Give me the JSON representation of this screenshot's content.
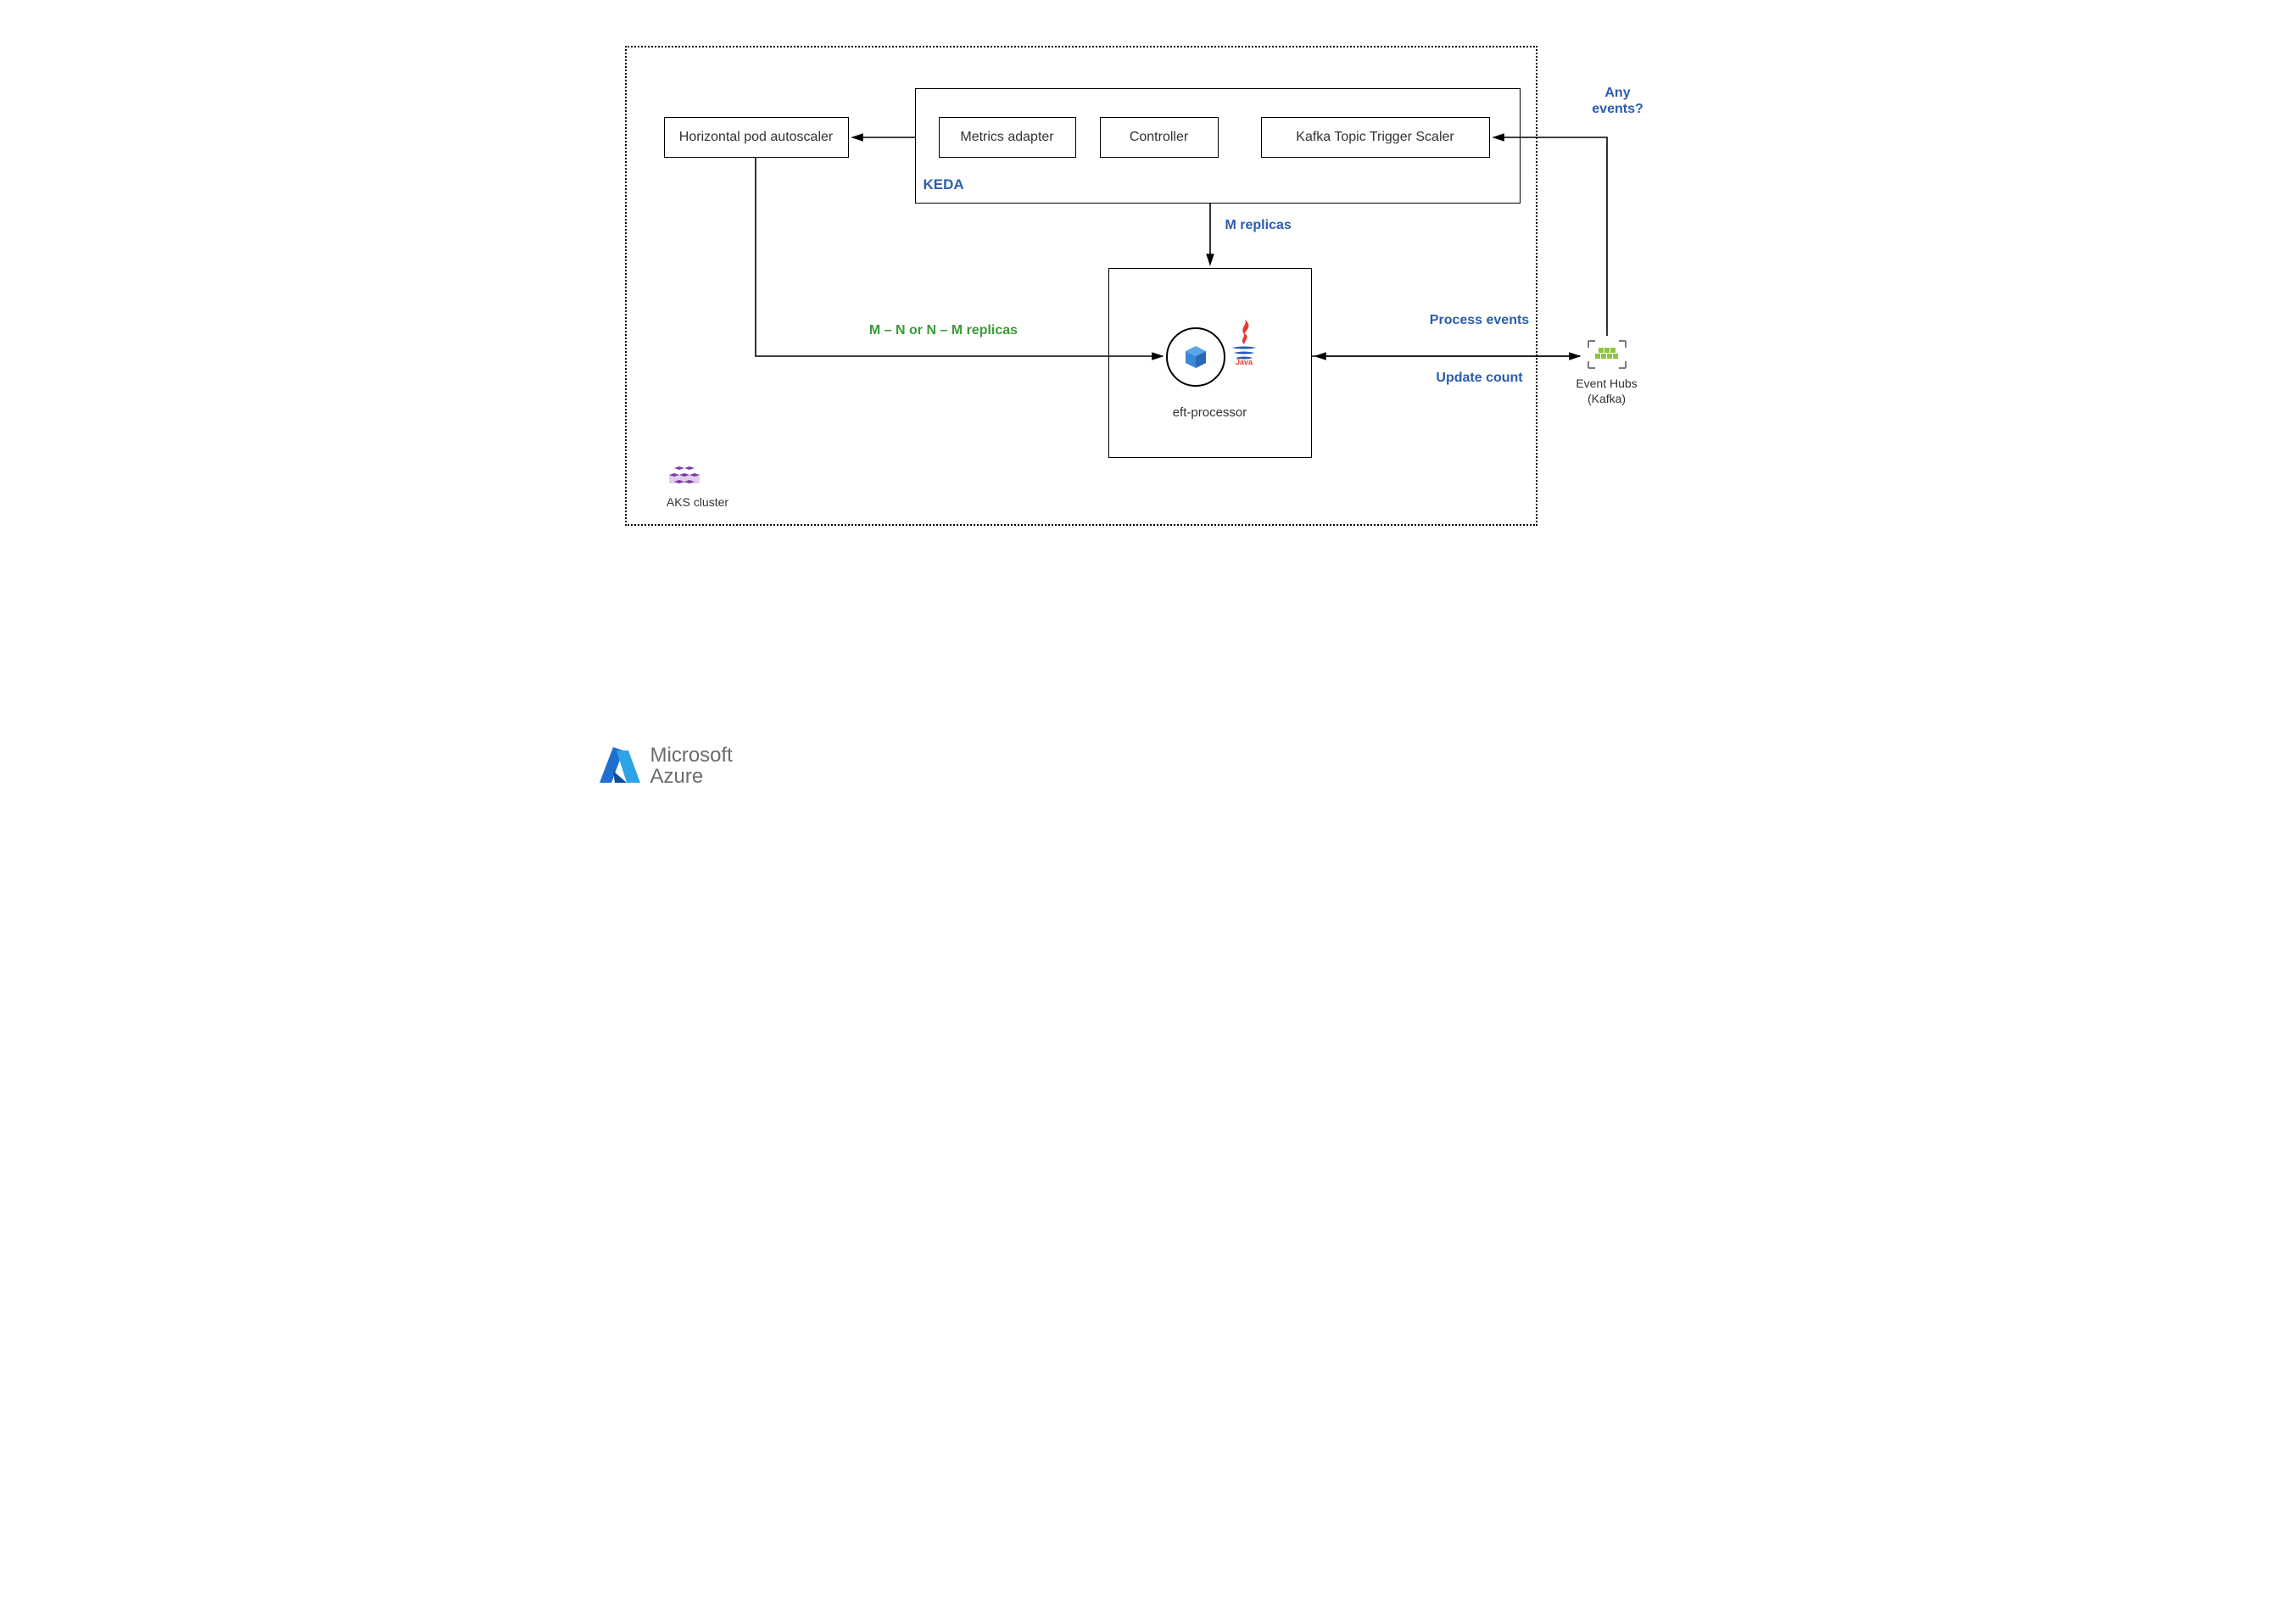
{
  "cluster": {
    "border_label": "AKS cluster"
  },
  "hpa": {
    "label": "Horizontal pod autoscaler"
  },
  "keda": {
    "group_label": "KEDA",
    "metrics_adapter": "Metrics adapter",
    "controller": "Controller",
    "scaler": "Kafka Topic Trigger Scaler"
  },
  "processor": {
    "name": "eft-processor",
    "icon_name": "java-cube-icon"
  },
  "edges": {
    "m_replicas": "M replicas",
    "hpa_replicas": "M – N or N – M replicas",
    "any_events": "Any events?",
    "process_events": "Process events",
    "update_count": "Update count"
  },
  "event_hubs": {
    "title": "Event Hubs",
    "subtitle": "(Kafka)"
  },
  "brand": {
    "line1": "Microsoft",
    "line2": "Azure"
  }
}
